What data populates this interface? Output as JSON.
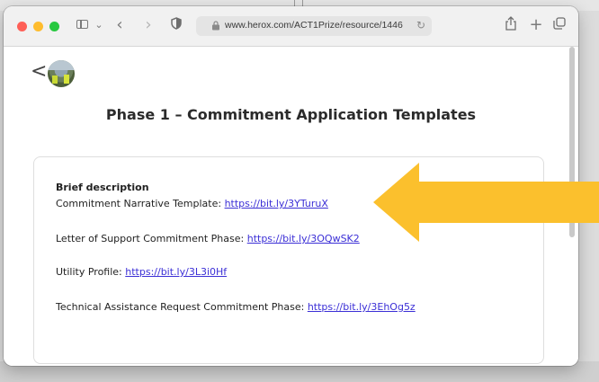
{
  "browser": {
    "url": "www.herox.com/ACT1Prize/resource/1446",
    "icons": [
      "sidebar-icon",
      "chevron-down-icon",
      "back-icon",
      "forward-icon",
      "shield-icon",
      "lock-icon",
      "reload-icon",
      "share-icon",
      "plus-icon",
      "tabs-icon"
    ]
  },
  "page": {
    "back_label": "<",
    "title": "Phase 1 – Commitment Application Templates",
    "description_heading": "Brief description",
    "items": [
      {
        "label": "Commitment Narrative Template: ",
        "link": "https://bit.ly/3YTuruX"
      },
      {
        "label": "Letter of Support Commitment Phase: ",
        "link": "https://bit.ly/3OQwSK2"
      },
      {
        "label": "Utility Profile: ",
        "link": "https://bit.ly/3L3i0Hf"
      },
      {
        "label": "Technical Assistance Request Commitment Phase: ",
        "link": "https://bit.ly/3EhOg5z"
      }
    ]
  },
  "annotation": {
    "arrow_color": "#fbc02d",
    "arrow_target": "Commitment Narrative Template link"
  }
}
